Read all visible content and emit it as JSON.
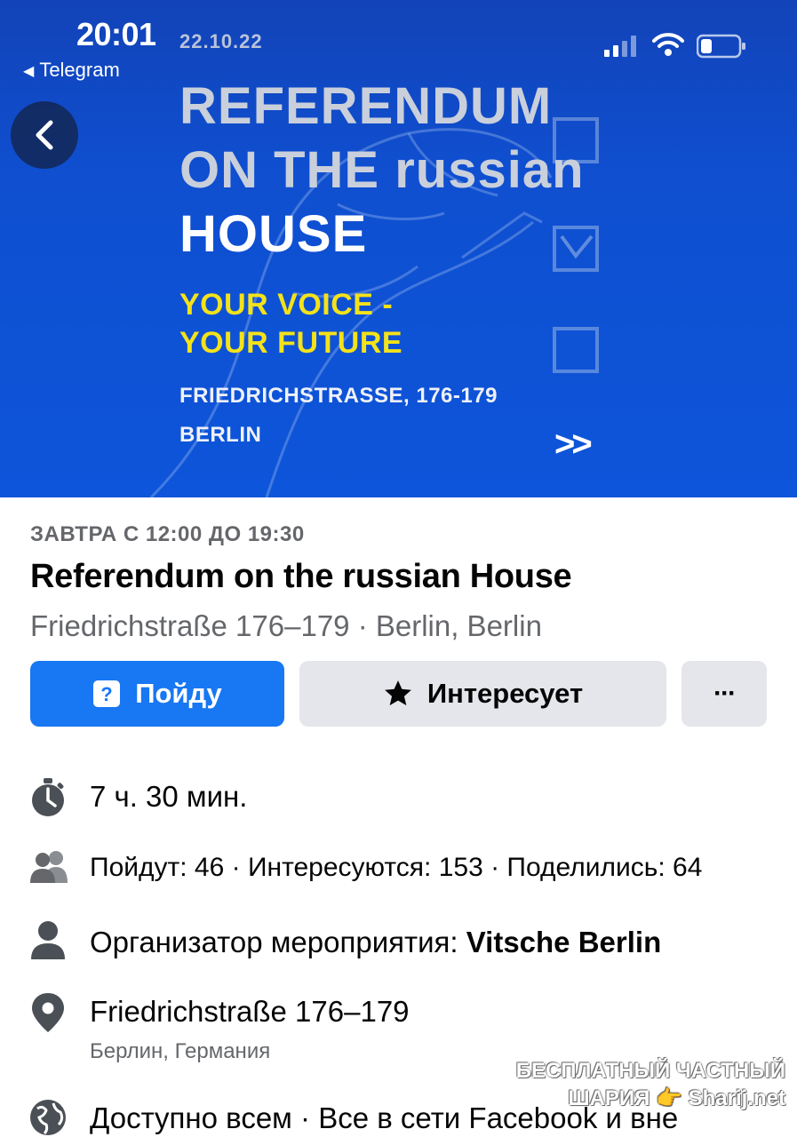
{
  "status_bar": {
    "time": "20:01",
    "back_app": "Telegram",
    "icons": [
      "cellular-signal-icon",
      "wifi-icon",
      "battery-icon"
    ]
  },
  "cover": {
    "date": "22.10.22",
    "title_line1": "REFERENDUM",
    "title_line2": "ON THE russian",
    "title_line3": "HOUSE",
    "slogan_line1": "YOUR VOICE -",
    "slogan_line2": "YOUR FUTURE",
    "address": "FRIEDRICHSTRASSE, 176-179",
    "city": "BERLIN",
    "arrows": ">>"
  },
  "event": {
    "when": "ЗАВТРА С 12:00 ДО 19:30",
    "title": "Referendum on the russian House",
    "location_line": "Friedrichstraße 176–179 · Berlin, Berlin"
  },
  "actions": {
    "going_label": "Пойду",
    "interested_label": "Интересует",
    "more_label": "···"
  },
  "details": {
    "duration": "7 ч. 30 мин.",
    "stats": "Пойдут: 46 · Интересуются: 153 · Поделились: 64",
    "organizer_prefix": "Организатор мероприятия: ",
    "organizer_name": "Vitsche Berlin",
    "address_street": "Friedrichstraße 176–179",
    "address_city": "Берлин, Германия",
    "privacy": "Доступно всем · Все в сети Facebook и вне"
  },
  "watermark": {
    "line1": "БЕСПЛАТНЫЙ ЧАСТНЫЙ",
    "line2": "ШАРИЯ 👉 Sharij.net"
  },
  "colors": {
    "facebook_blue": "#1877f2",
    "cover_blue": "#0f4fd0",
    "slogan_yellow": "#f4e21a",
    "secondary_text": "#65676b",
    "button_gray": "#e4e6eb"
  }
}
